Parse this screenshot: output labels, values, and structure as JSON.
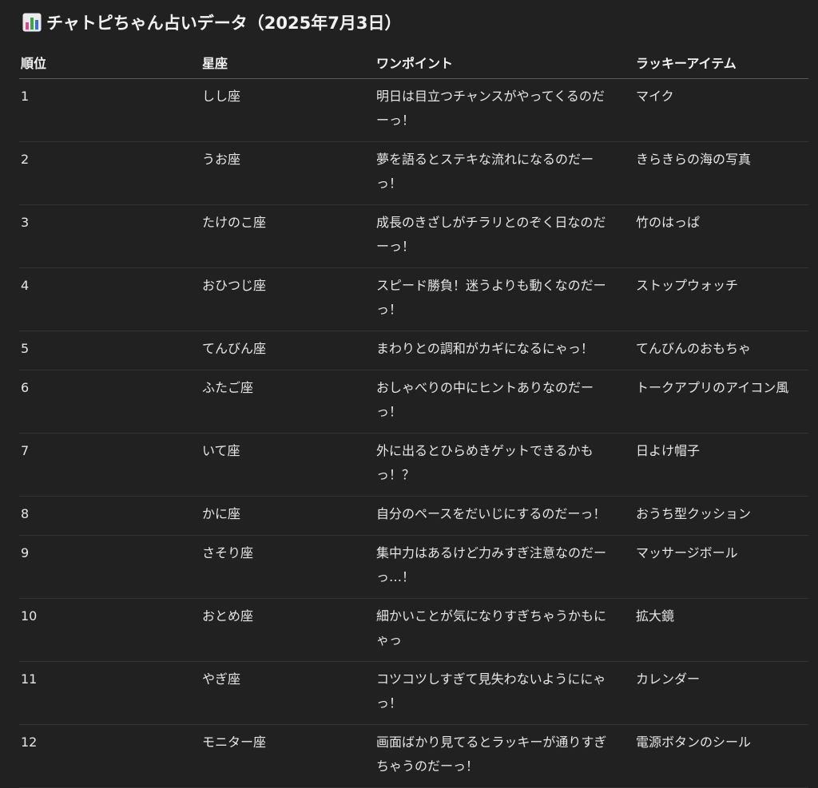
{
  "title": "チャトピちゃん占いデータ（2025年7月3日）",
  "title_icon": "bar-chart-icon",
  "table": {
    "headers": [
      "順位",
      "星座",
      "ワンポイント",
      "ラッキーアイテム"
    ],
    "rows": [
      {
        "rank": "1",
        "sign": "しし座",
        "point": "明日は目立つチャンスがやってくるのだーっ！",
        "item": "マイク"
      },
      {
        "rank": "2",
        "sign": "うお座",
        "point": "夢を語るとステキな流れになるのだーっ！",
        "item": "きらきらの海の写真"
      },
      {
        "rank": "3",
        "sign": "たけのこ座",
        "point": "成長のきざしがチラリとのぞく日なのだーっ！",
        "item": "竹のはっぱ"
      },
      {
        "rank": "4",
        "sign": "おひつじ座",
        "point": "スピード勝負！迷うよりも動くなのだーっ！",
        "item": "ストップウォッチ"
      },
      {
        "rank": "5",
        "sign": "てんびん座",
        "point": "まわりとの調和がカギになるにゃっ！",
        "item": "てんびんのおもちゃ"
      },
      {
        "rank": "6",
        "sign": "ふたご座",
        "point": "おしゃべりの中にヒントありなのだーっ！",
        "item": "トークアプリのアイコン風"
      },
      {
        "rank": "7",
        "sign": "いて座",
        "point": "外に出るとひらめきゲットできるかもっ！？",
        "item": "日よけ帽子"
      },
      {
        "rank": "8",
        "sign": "かに座",
        "point": "自分のペースをだいじにするのだーっ！",
        "item": "おうち型クッション"
      },
      {
        "rank": "9",
        "sign": "さそり座",
        "point": "集中力はあるけど力みすぎ注意なのだーっ…！",
        "item": "マッサージボール"
      },
      {
        "rank": "10",
        "sign": "おとめ座",
        "point": "細かいことが気になりすぎちゃうかもにゃっ",
        "item": "拡大鏡"
      },
      {
        "rank": "11",
        "sign": "やぎ座",
        "point": "コツコツしすぎて見失わないようににゃっ！",
        "item": "カレンダー"
      },
      {
        "rank": "12",
        "sign": "モニター座",
        "point": "画面ばかり見てるとラッキーが通りすぎちゃうのだーっ！",
        "item": "電源ボタンのシール"
      }
    ]
  }
}
